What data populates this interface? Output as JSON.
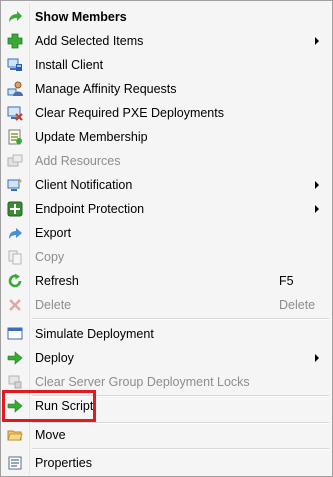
{
  "context_menu": {
    "items": [
      {
        "label": "Show Members",
        "icon": "arrow-right-icon"
      },
      {
        "label": "Add Selected Items",
        "icon": "plus-icon"
      },
      {
        "label": "Install Client",
        "icon": "install-client-icon"
      },
      {
        "label": "Manage Affinity Requests",
        "icon": "user-affinity-icon"
      },
      {
        "label": "Clear Required PXE Deployments",
        "icon": "pxe-clear-icon"
      },
      {
        "label": "Update Membership",
        "icon": "update-membership-icon"
      },
      {
        "label": "Add Resources",
        "icon": "add-resources-icon"
      },
      {
        "label": "Client Notification",
        "icon": "client-notification-icon"
      },
      {
        "label": "Endpoint Protection",
        "icon": "endpoint-protection-icon"
      },
      {
        "label": "Export",
        "icon": "export-icon"
      },
      {
        "label": "Copy",
        "icon": "copy-icon"
      },
      {
        "label": "Refresh",
        "icon": "refresh-icon",
        "shortcut": "F5"
      },
      {
        "label": "Delete",
        "icon": "delete-icon",
        "shortcut": "Delete"
      },
      {
        "label": "Simulate Deployment",
        "icon": "simulate-deployment-icon"
      },
      {
        "label": "Deploy",
        "icon": "deploy-icon"
      },
      {
        "label": "Clear Server Group Deployment Locks",
        "icon": "clear-locks-icon"
      },
      {
        "label": "Run Script",
        "icon": "run-script-icon"
      },
      {
        "label": "Move",
        "icon": "move-folder-icon"
      },
      {
        "label": "Properties",
        "icon": "properties-icon"
      }
    ]
  },
  "colors": {
    "highlight_border": "#e01a21",
    "disabled_text": "#8d8d8d",
    "menu_background": "#f5f5f5",
    "green_arrow": "#3aa935"
  }
}
